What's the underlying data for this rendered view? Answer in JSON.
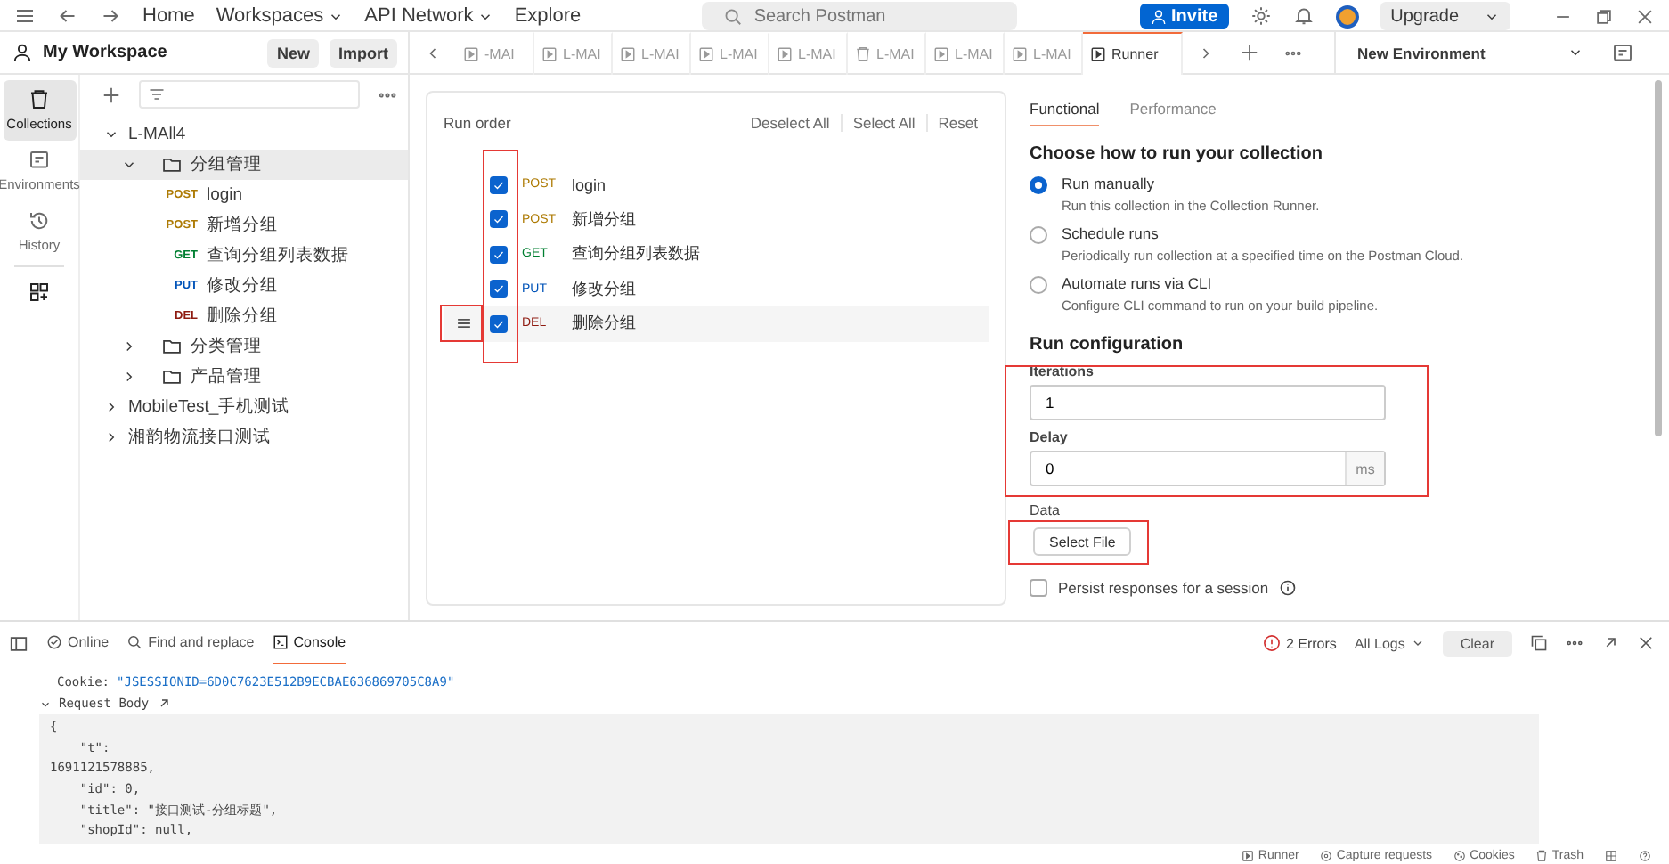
{
  "topbar": {
    "nav": [
      {
        "label": "Home",
        "dropdown": false
      },
      {
        "label": "Workspaces",
        "dropdown": true
      },
      {
        "label": "API Network",
        "dropdown": true
      },
      {
        "label": "Explore",
        "dropdown": false
      }
    ],
    "search": {
      "placeholder": "Search Postman"
    },
    "invite": "Invite",
    "upgrade": "Upgrade"
  },
  "workspace": {
    "name": "My Workspace",
    "buttons": [
      "New",
      "Import"
    ]
  },
  "sidebar_nav": [
    {
      "label": "Collections",
      "kind": "collections",
      "selected": true
    },
    {
      "label": "Environments",
      "kind": "environments",
      "selected": false
    },
    {
      "label": "History",
      "kind": "history",
      "selected": false
    }
  ],
  "tree": [
    {
      "label": "L-MAll4",
      "kind": "collection",
      "expanded": true,
      "selected": false,
      "children": [
        {
          "label": "分组管理",
          "kind": "folder",
          "expanded": true,
          "selected": true,
          "children": [
            {
              "label": "login",
              "kind": "request",
              "method": "POST"
            },
            {
              "label": "新增分组",
              "kind": "request",
              "method": "POST"
            },
            {
              "label": "查询分组列表数据",
              "kind": "request",
              "method": "GET"
            },
            {
              "label": "修改分组",
              "kind": "request",
              "method": "PUT"
            },
            {
              "label": "删除分组",
              "kind": "request",
              "method": "DEL"
            }
          ]
        },
        {
          "label": "分类管理",
          "kind": "folder",
          "expanded": false,
          "selected": false
        },
        {
          "label": "产品管理",
          "kind": "folder",
          "expanded": false,
          "selected": false
        }
      ]
    },
    {
      "label": "MobileTest_手机测试",
      "kind": "collection",
      "expanded": false,
      "selected": false
    },
    {
      "label": "湘韵物流接口测试",
      "kind": "collection",
      "expanded": false,
      "selected": false
    }
  ],
  "tabs": [
    {
      "label": "-MAI",
      "kind": "runner",
      "selected": false
    },
    {
      "label": "L-MAI",
      "kind": "runner",
      "selected": false
    },
    {
      "label": "L-MAI",
      "kind": "runner",
      "selected": false
    },
    {
      "label": "L-MAI",
      "kind": "runner",
      "selected": false
    },
    {
      "label": "L-MAI",
      "kind": "runner",
      "selected": false
    },
    {
      "label": "L-MAI",
      "kind": "collection",
      "selected": false
    },
    {
      "label": "L-MAI",
      "kind": "runner",
      "selected": false
    },
    {
      "label": "L-MAI",
      "kind": "runner",
      "selected": false
    },
    {
      "label": "Runner",
      "kind": "runner",
      "selected": true
    }
  ],
  "environment": "New Environment",
  "run_order": {
    "title": "Run order",
    "actions": [
      "Deselect All",
      "Select All",
      "Reset"
    ],
    "checkboxes_annotated": true,
    "items": [
      {
        "method": "POST",
        "name": "login",
        "checked": true,
        "hovered": false
      },
      {
        "method": "POST",
        "name": "新增分组",
        "checked": true,
        "hovered": false
      },
      {
        "method": "GET",
        "name": "查询分组列表数据",
        "checked": true,
        "hovered": false
      },
      {
        "method": "PUT",
        "name": "修改分组",
        "checked": true,
        "hovered": false
      },
      {
        "method": "DEL",
        "name": "删除分组",
        "checked": true,
        "hovered": true
      }
    ]
  },
  "runner_tabs": [
    {
      "label": "Functional",
      "selected": true
    },
    {
      "label": "Performance",
      "selected": false
    }
  ],
  "run_mode": {
    "title": "Choose how to run your collection",
    "options": [
      {
        "label": "Run manually",
        "description": "Run this collection in the Collection Runner.",
        "selected": true
      },
      {
        "label": "Schedule runs",
        "description": "Periodically run collection at a specified time on the Postman Cloud.",
        "selected": false
      },
      {
        "label": "Automate runs via CLI",
        "description": "Configure CLI command to run on your build pipeline.",
        "selected": false
      }
    ]
  },
  "config": {
    "title": "Run configuration",
    "fields_annotated": true,
    "fields": [
      {
        "label": "Iterations",
        "value": "1"
      },
      {
        "label": "Delay",
        "value": "0",
        "unit": "ms"
      }
    ],
    "data_label": "Data",
    "select_file": "Select File",
    "select_file_annotated": true,
    "persist": {
      "label": "Persist responses for a session",
      "checked": false
    }
  },
  "console": {
    "tabs": [
      {
        "label": "Online",
        "kind": "online",
        "selected": false
      },
      {
        "label": "Find and replace",
        "kind": "find",
        "selected": false
      },
      {
        "label": "Console",
        "kind": "console",
        "selected": true
      }
    ],
    "errors": "2 Errors",
    "filter": "All Logs",
    "clear": "Clear",
    "cookie": {
      "key": "Cookie:",
      "value": "\"JSESSIONID=6D0C7623E512B9ECBAE636869705C8A9\""
    },
    "section": "Request Body",
    "body": [
      "{",
      "    \"t\":",
      "1691121578885,",
      "    \"id\": 0,",
      "    \"title\": \"接口测试-分组标题\",",
      "    \"shopId\": null,"
    ]
  },
  "status_bar": [
    "Runner",
    "Capture requests",
    "Cookies",
    "Trash"
  ]
}
